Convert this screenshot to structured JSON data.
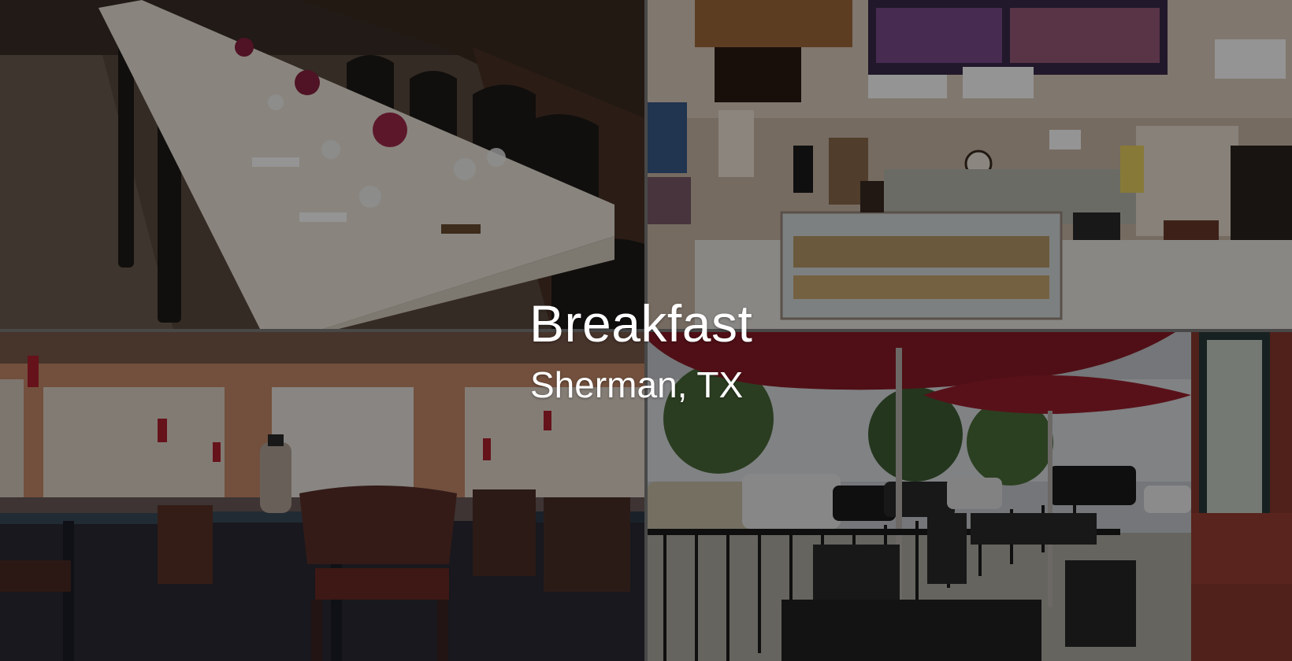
{
  "hero": {
    "title": "Breakfast",
    "subtitle": "Sherman, TX",
    "text_color": "#ffffff",
    "overlay_color": "#000000"
  },
  "photos": [
    {
      "name": "banquet-table-photo"
    },
    {
      "name": "bakery-counter-photo"
    },
    {
      "name": "dining-room-photo"
    },
    {
      "name": "patio-umbrellas-photo"
    }
  ]
}
